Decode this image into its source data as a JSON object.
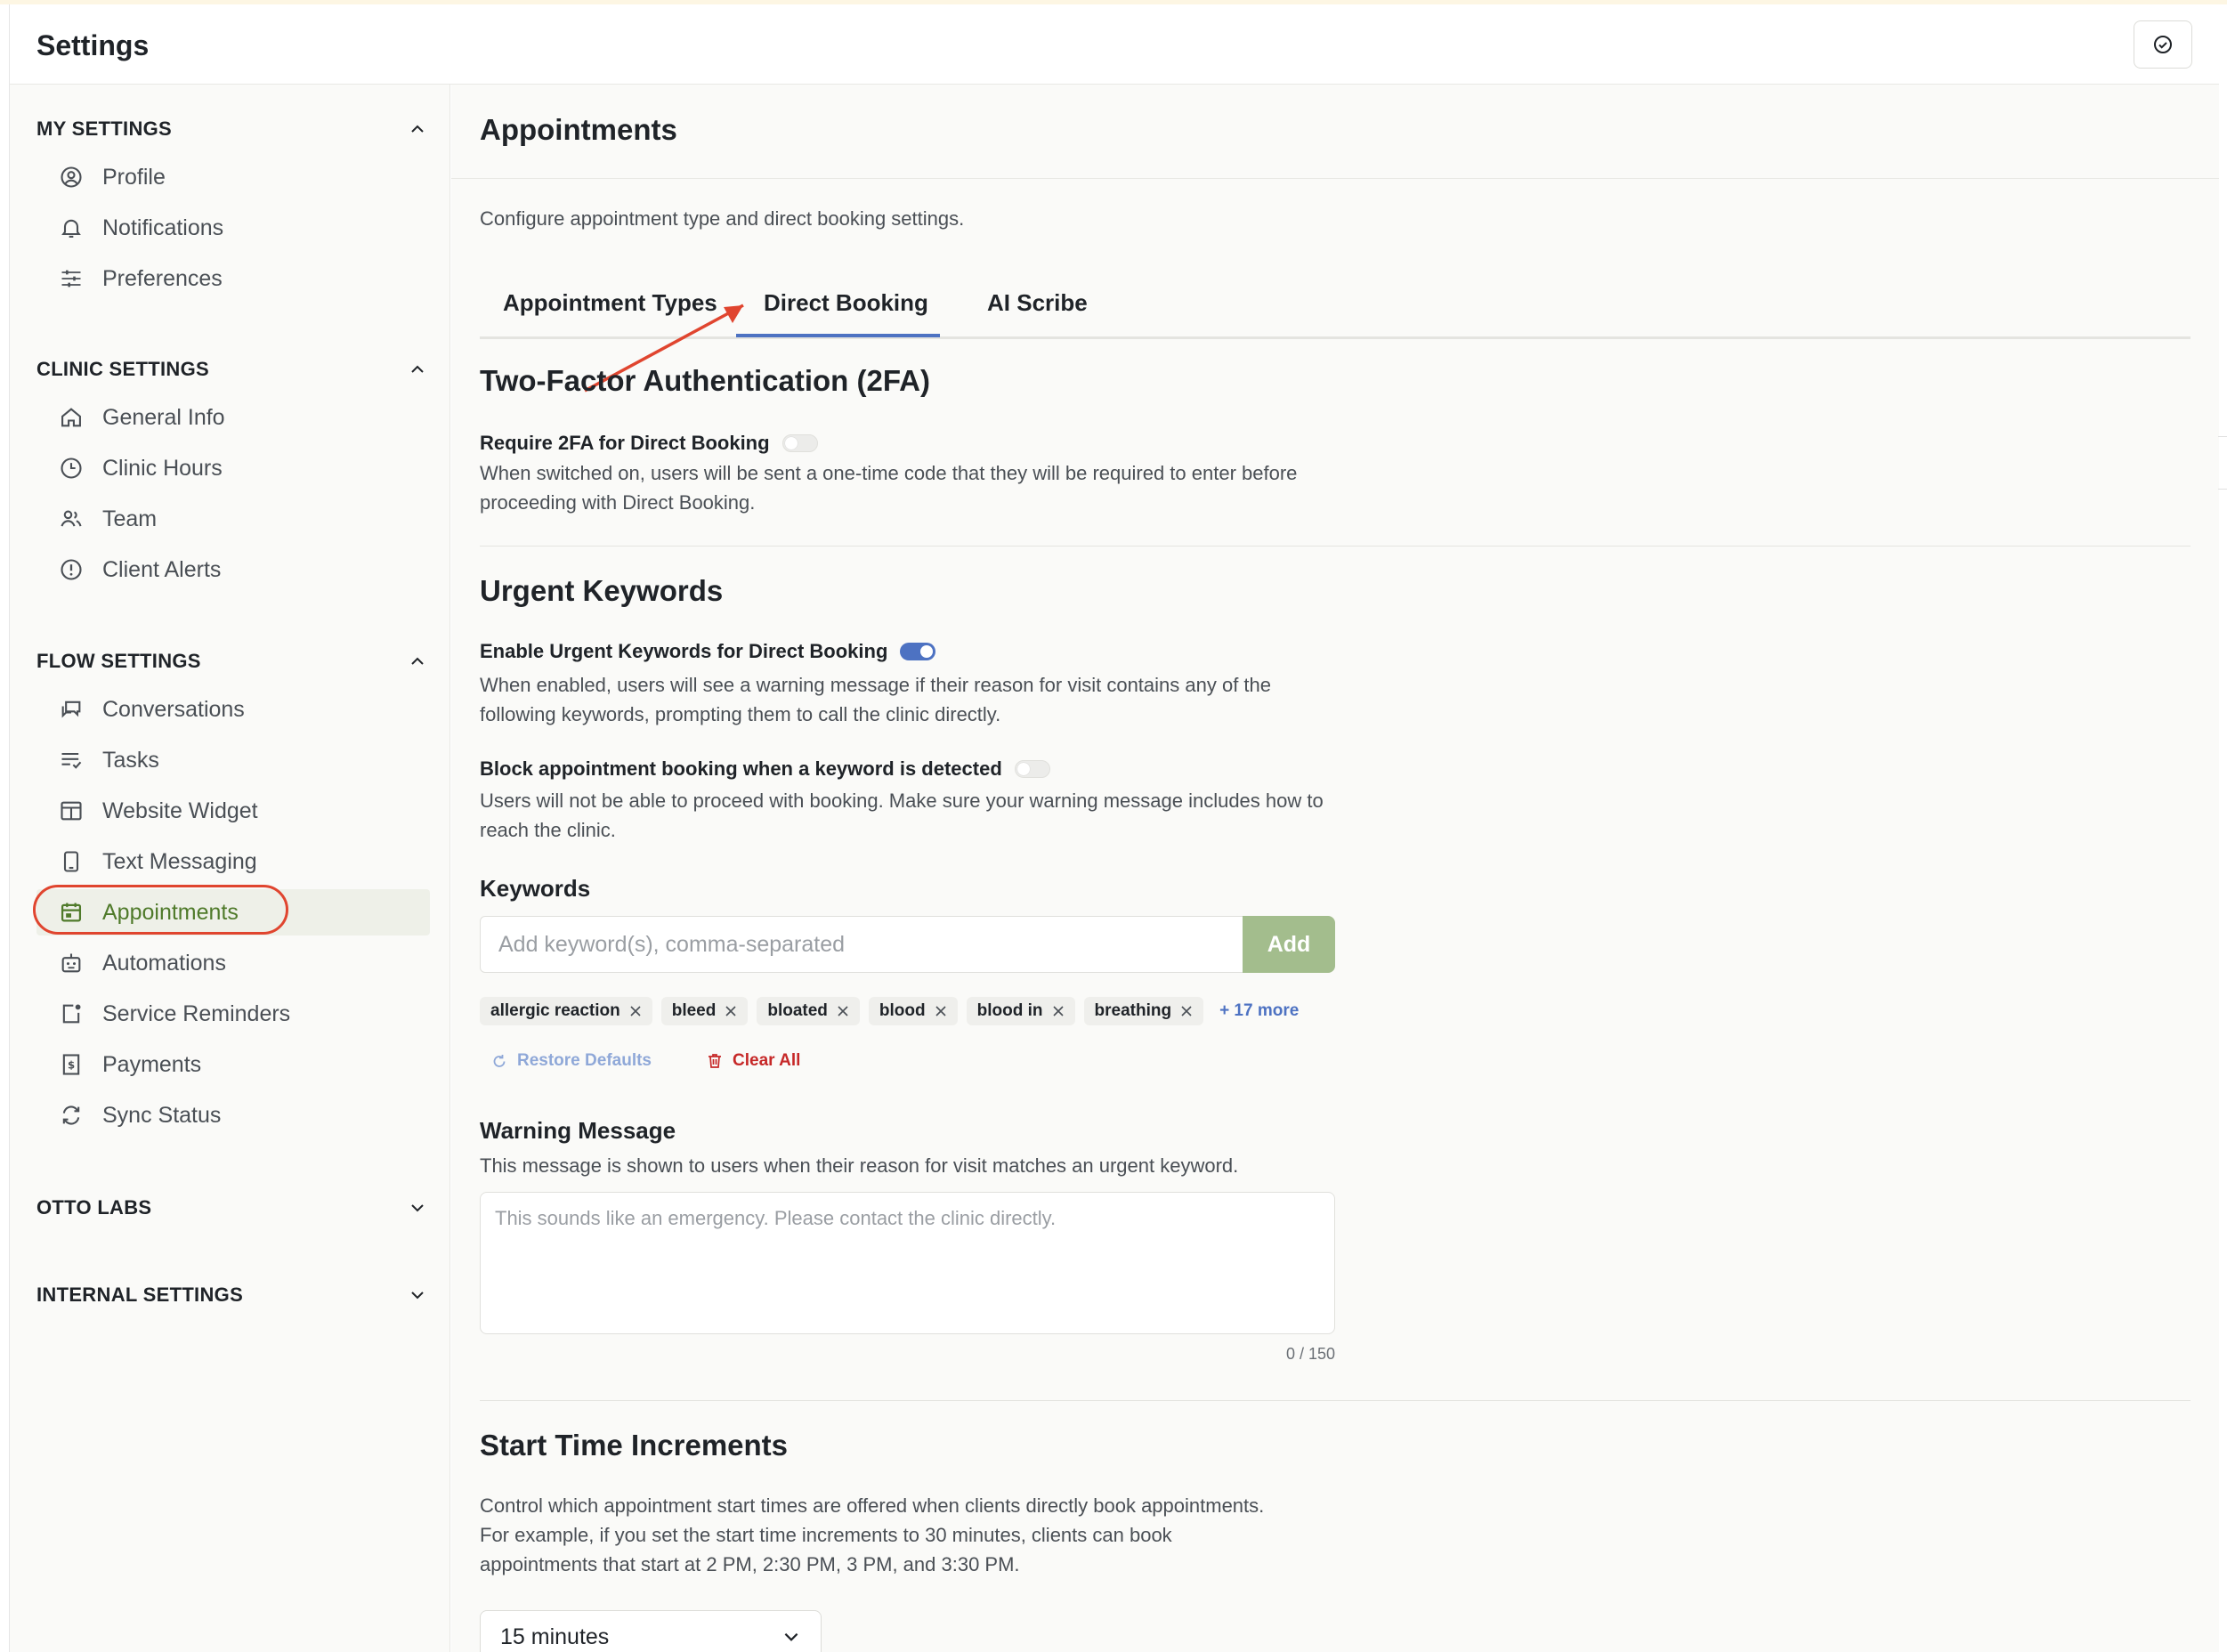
{
  "header": {
    "title": "Settings",
    "action_icon": "check-circle-icon"
  },
  "sidebar": {
    "sections": [
      {
        "label": "MY SETTINGS",
        "items": [
          "Profile",
          "Notifications",
          "Preferences"
        ]
      },
      {
        "label": "CLINIC SETTINGS",
        "items": [
          "General Info",
          "Clinic Hours",
          "Team",
          "Client Alerts"
        ]
      },
      {
        "label": "FLOW SETTINGS",
        "items": [
          "Conversations",
          "Tasks",
          "Website Widget",
          "Text Messaging",
          "Appointments",
          "Automations",
          "Service Reminders",
          "Payments",
          "Sync Status"
        ]
      },
      {
        "label": "OTTO LABS",
        "items": []
      },
      {
        "label": "INTERNAL SETTINGS",
        "items": []
      }
    ],
    "active_item": "Appointments",
    "active_color": "#4f7a2a",
    "highlight_color": "#e0452f"
  },
  "main": {
    "title": "Appointments",
    "description": "Configure appointment type and direct booking settings.",
    "tabs": [
      "Appointment Types",
      "Direct Booking",
      "AI Scribe"
    ],
    "active_tab": "Direct Booking",
    "twofa": {
      "heading": "Two-Factor Authentication (2FA)",
      "label": "Require 2FA for Direct Booking",
      "enabled": false,
      "description": "When switched on, users will be sent a one-time code that they will be required to enter before proceeding with Direct Booking."
    },
    "urgent": {
      "heading": "Urgent Keywords",
      "enable_label": "Enable Urgent Keywords for Direct Booking",
      "enable_on": true,
      "enable_description": "When enabled, users will see a warning message if their reason for visit contains any of the following keywords, prompting them to call the clinic directly.",
      "block_label": "Block appointment booking when a keyword is detected",
      "block_on": false,
      "block_description": "Users will not be able to proceed with booking. Make sure your warning message includes how to reach the clinic."
    },
    "keywords": {
      "title": "Keywords",
      "placeholder": "Add keyword(s), comma-separated",
      "add_label": "Add",
      "chips": [
        "allergic reaction",
        "bleed",
        "bloated",
        "blood",
        "blood in",
        "breathing"
      ],
      "more": "+ 17 more",
      "restore_label": "Restore Defaults",
      "clear_label": "Clear All"
    },
    "warning": {
      "title": "Warning Message",
      "description": "This message is shown to users when their reason for visit matches an urgent keyword.",
      "placeholder": "This sounds like an emergency. Please contact the clinic directly.",
      "counter": "0 / 150"
    },
    "start_time": {
      "heading": "Start Time Increments",
      "description": "Control which appointment start times are offered when clients directly book appointments. For example, if you set the start time increments to 30 minutes, clients can book appointments that start at 2 PM, 2:30 PM, 3 PM, and 3:30 PM.",
      "selected": "15 minutes"
    },
    "colors": {
      "accent": "#4d72c2",
      "add_button": "#a3bd8d",
      "danger": "#c62828"
    }
  }
}
